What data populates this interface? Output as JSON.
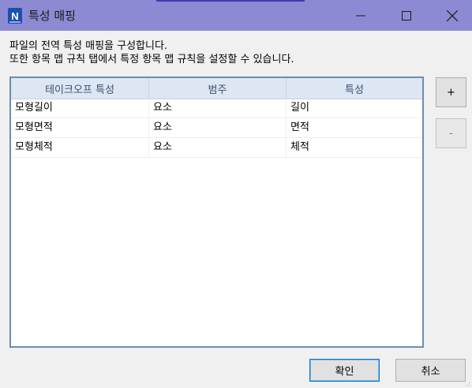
{
  "window": {
    "title": "특성 매핑",
    "app_icon_letter": "N"
  },
  "description": {
    "line1": "파일의 전역 특성 매핑을 구성합니다.",
    "line2": "또한 항목 맵 규칙 탭에서 특정 항목 맵 규칙을 설정할 수 있습니다."
  },
  "grid": {
    "columns": [
      "테이크오프 특성",
      "범주",
      "특성"
    ],
    "rows": [
      [
        "모형길이",
        "요소",
        "길이"
      ],
      [
        "모형면적",
        "요소",
        "면적"
      ],
      [
        "모형체적",
        "요소",
        "체적"
      ]
    ]
  },
  "side_buttons": {
    "add": "+",
    "remove": "-"
  },
  "footer": {
    "ok": "확인",
    "cancel": "취소"
  },
  "colors": {
    "titlebar": "#8c8ad2",
    "grid_border": "#6a8fb0",
    "header_bg": "#dde6f3",
    "primary_border": "#0078d7"
  }
}
